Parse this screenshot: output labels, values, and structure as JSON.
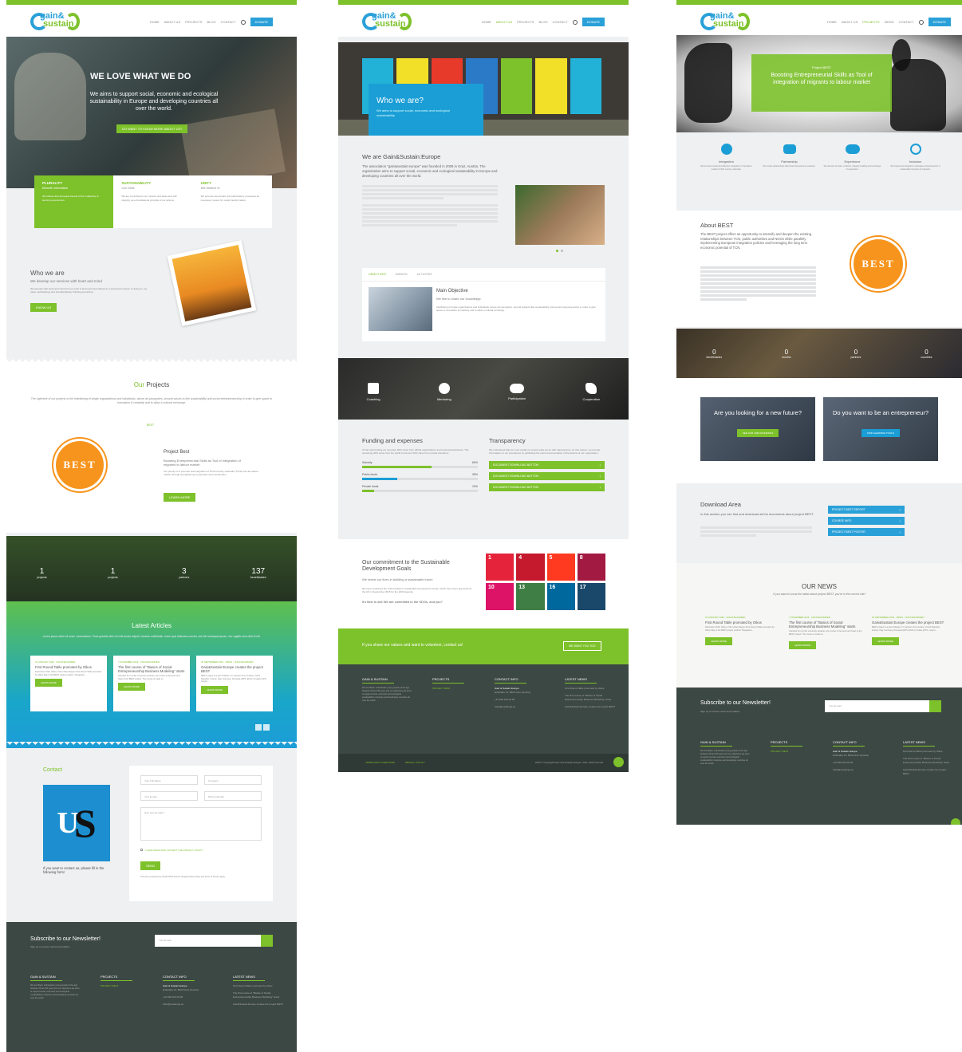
{
  "colors": {
    "green": "#7dc12b",
    "blue": "#2aa0d8",
    "dark": "#3c4843"
  },
  "logo": {
    "line1": "gain&",
    "line2": "sustain"
  },
  "nav": {
    "home": "HOME",
    "about": "ABOUT US",
    "projects": "PROJECTS",
    "blog": "BLOG",
    "news": "NEWS",
    "contact": "CONTACT",
    "donate": "DONATE"
  },
  "p1": {
    "hero_title": "WE LOVE WHAT WE DO",
    "hero_text": "We aims to support social, economic and ecological sustainability in Europe and developing countries all over the world.",
    "hero_btn": "DO WANT TO KNOW MORE ABOUT US?",
    "values": [
      {
        "title": "PLURALITY",
        "sub": "Benefit orientation",
        "text": "We believe that all people benefit of the multiplicity of learning experiences."
      },
      {
        "title": "SUSTAINABILITY",
        "sub": "Our DNA",
        "text": "We are committed to our mission and ideas and with integrity, as a foundational principle of our actions."
      },
      {
        "title": "UNITY",
        "sub": "We believe in",
        "text": "We promote democratic and participatory processes as necessary means for social transformation."
      }
    ],
    "who_title": "Who we are",
    "who_sub": "We develop our services with heart and mind",
    "who_text": "We develop with heart and mind and our work is all around and offered in a structured content. In doing so, we value methodology and interdisciplinary thinking and acting.",
    "who_btn": "KNOW US",
    "proj_title_a": "Our",
    "proj_title_b": "Projects",
    "proj_text": "The objective of our projects is the interlinking of single organizations and individuals, above all youngsters, around values to like sustainability and social entrepreneurship in order to give space to innovation & creativity and to allow a cultural exchange.",
    "proj_tab": "BEST",
    "best_logo": "BEST",
    "best_title": "Project Best",
    "best_sub": "Boosting Entrepreneurial Skills as Tool of integration of migrants to labour market",
    "best_text": "Our priority is to promote self-integration of Third Country nationals (TCNs) into the labour market through strengthening cooperation and coordination.",
    "best_btn": "LEARN MORE",
    "stats": [
      {
        "n": "1",
        "l": "projects"
      },
      {
        "n": "1",
        "l": "projects"
      },
      {
        "n": "3",
        "l": "partners"
      },
      {
        "n": "137",
        "l": "beneficiaries"
      }
    ],
    "art_title": "Latest Articles",
    "art_text": "Lorem ipsum dolor sit amet, consectetuer. Proin gravida nibh vel velit auctor aliquet. Aenean sollicitudin, lorem quis bibendum auctor, nisi elit consequat ipsum, nec sagittis sem nibh id elit.",
    "articles": [
      {
        "meta": "15 JANUARY 2020 · UNCATEGORIZED",
        "title": "First Round Table promoted by Oikos",
        "text": "December 2019, Oikos of the Urban Region First Round Table promoted by Oikos Italy to the BEST project product \"Integration...",
        "btn": "LEARN MORE"
      },
      {
        "meta": "7 NOVEMBER 2019 · UNCATEGORIZED",
        "title": "The first course of \"Basics of Social Entrepreneurship Business Modeling\" starts",
        "text": "Intended for non EU university students, the course is the heart and heart of the BEST project. The course is made to...",
        "btn": "LEARN MORE"
      },
      {
        "meta": "30 SEPTEMBER 2019 · NEWS · UNCATEGORIZED",
        "title": "Gain&Sustain:Europe creates the project BEST",
        "text": "BEST project is a joint initiative of 7 partners from Austria, Czech Republic, France, Italy, Germany, Romania (DPS, EUCL) Croatia (CPS, mayor)...",
        "btn": "LEARN MORE"
      }
    ],
    "contact_title": "Contact",
    "contact_text": "If you want to contact us, please fill in the following form!",
    "form": {
      "name": "Your Full Name",
      "company": "Company",
      "email": "Your E-mail",
      "phone": "Phone Number",
      "message": "How can we help?",
      "privacy": "I HAVE READ AND I ACCEPT THE PRIVACY POLICY",
      "send": "SEND",
      "recaptcha": "This site is protected by reCAPTCHA and the Google Privacy Policy and Terms of Service apply."
    }
  },
  "newsletter": {
    "title": "Subscribe to our Newsletter!",
    "sub": "Sign up to receive news and updates",
    "placeholder": "Your E-mail"
  },
  "footer": {
    "col1_title": "GAIN & SUSTAIN",
    "col1_text": "We are fifteen enthusiastic young people at the age between 25 and 35 years and our objectives are aims to support social, economic and ecological sustainability in Europe and developing countries all over the world.",
    "col2_title": "PROJECTS",
    "col2_item": "PROJECT BEST",
    "col3_title": "CONTACT INFO",
    "col3_addr": "Gain & Sustain Europe",
    "col3_street": "Ertlstraße 14, 8020 Graz (Austria)",
    "col3_phone": "+43 699 100 00 00",
    "col3_mail": "hello@sustaings.eu",
    "col4_title": "LATEST NEWS",
    "news": [
      "First Round Table promoted by Oikos",
      "The first course of \"Basics of Social Entrepreneurship Business Modeling\" starts",
      "Gain&Sustain:Europe creates the project BEST"
    ],
    "copyright": "2020 © Copyright Gain and Sustain Europe, Tutti i diritti riservati",
    "privacy": "PRIVACY POLICY",
    "terms": "TERMS AND CONDITIONS"
  },
  "p2": {
    "hero_title": "Who we are?",
    "hero_text": "We aims to support social, economic and ecological sustainability",
    "sec_title": "We are Gain&Sustain:Europe",
    "sec_text": "The association \"gain&sustain:europe\" was founded in 2009 in Graz, Austria. The organization aims to support social, economic and ecological sustainability in Europe and developing countries all over the world.",
    "tabs": [
      "OBJECTIVES",
      "MISSION",
      "ACTIVITIES"
    ],
    "obj_title": "Main Objective",
    "obj_sub": "We like to share our knowledge",
    "obj_text": "Interlinking of single organizations and individuals, above all youngsters, around subjects like sustainability and social entrepreneurship in order to give space to innovation & creativity and to allow a cultural exchange.",
    "icons": [
      "Coaching",
      "Mentoring",
      "Participation",
      "Cooperation"
    ],
    "fund_title": "Funding and expenses",
    "fund_text": "Of the total funding we received, 60% came from official organizations and local administrations. The remaining 40% came from the public funds and 10% came from private donations.",
    "fund_bars": [
      {
        "l": "Subsidy",
        "v": "60%",
        "p": 60
      },
      {
        "l": "Public funds",
        "v": "30%",
        "p": 30
      },
      {
        "l": "Private funds",
        "v": "10%",
        "p": 10
      }
    ],
    "trans_title": "Transparency",
    "trans_text": "We understand that we must explain to society what we do with transparency; for this reason, we provide information on our procedures by publishing the entire documentation of the actions of our organization.",
    "doc_btns": [
      "DOCUMENT DOWNLOAD BUTTON",
      "DOCUMENT DOWNLOAD BUTTON",
      "DOCUMENT DOWNLOAD BUTTON"
    ],
    "sdg_title": "Our commitment to the Sustainable Development Goals",
    "sdg_sub": "We invest our lives in building a sustainable future",
    "sdg_text": "We have embraced the United Nations' Sustainable Development Goals, which have been approved by the UN in September 2015 for the 2030 Agenda.",
    "sdg_cta": "It's time to act! We are committed to the SDGs, and you?",
    "sdgs": [
      {
        "n": "1",
        "c": "#e5243b"
      },
      {
        "n": "4",
        "c": "#c5192d"
      },
      {
        "n": "5",
        "c": "#ff3a21"
      },
      {
        "n": "8",
        "c": "#a21942"
      },
      {
        "n": "10",
        "c": "#dd1367"
      },
      {
        "n": "13",
        "c": "#3f7e44"
      },
      {
        "n": "16",
        "c": "#00689d"
      },
      {
        "n": "17",
        "c": "#19486a"
      }
    ],
    "cta_text": "If you share our values and want to volunteer, contact us!",
    "cta_btn": "WE WANT YOU TOO"
  },
  "p3": {
    "hero_kicker": "Project BEST",
    "hero_title": "Boosting Entrepreneurial Skills as Tool of integration of migrants to labour market",
    "features": [
      {
        "t": "Integration",
        "d": "We promote social and effective integration in the labour market of third country nationals."
      },
      {
        "t": "Partnership",
        "d": "We create partnerships with local and economic partners."
      },
      {
        "t": "Experience",
        "d": "We develop of tools, methods, capacity building and exchange of experience."
      },
      {
        "t": "Inclusion",
        "d": "We implement integration strategies at local level for a sustainable inclusion of migrants."
      }
    ],
    "about_title": "About BEST",
    "about_text": "The BEST project offers an opportunity to intensify and deepen the existing relationships between TCN, public authorities and NGOs while parallely implementing European integration policies and leveraging the long term economic potential of TCN.",
    "best_logo": "BEST",
    "stats": [
      {
        "n": "0",
        "l": "beneficiaries"
      },
      {
        "n": "0",
        "l": "months"
      },
      {
        "n": "0",
        "l": "partners"
      },
      {
        "n": "0",
        "l": "countries"
      }
    ],
    "job_title": "Are you looking for a new future?",
    "job_btn": "SEE OUR JOB OFFERINGS",
    "ent_title": "Do you want to be an entrepreneur?",
    "ent_btn": "FIND LEARNING TOOLS",
    "dl_title": "Download Area",
    "dl_text": "In this section you can find and download all the documents about project BEST.",
    "dl_btns": [
      "PROJECT BEST REPORT",
      "COURSE INFO",
      "PROJECT BEST POSTER"
    ],
    "news_title": "OUR NEWS",
    "news_sub": "If you want to know the latest about project BEST you're in the correct site!"
  }
}
